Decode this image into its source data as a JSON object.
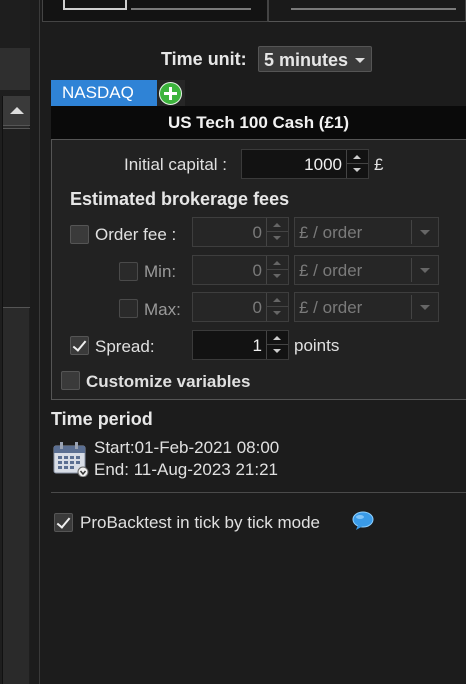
{
  "time_unit": {
    "label": "Time unit:",
    "value": "5 minutes"
  },
  "market_tab": {
    "label": "NASDAQ"
  },
  "instrument": {
    "name": "US Tech 100 Cash (£1)"
  },
  "capital": {
    "label": "Initial capital :",
    "value": "1000",
    "currency": "£"
  },
  "fees": {
    "title": "Estimated brokerage fees",
    "order_fee": {
      "label": "Order fee :",
      "value": "0",
      "unit": "£ / order",
      "checked": false
    },
    "min": {
      "label": "Min:",
      "value": "0",
      "unit": "£ / order",
      "checked": false
    },
    "max": {
      "label": "Max:",
      "value": "0",
      "unit": "£ / order",
      "checked": false
    },
    "spread": {
      "label": "Spread:",
      "value": "1",
      "unit": "points",
      "checked": true
    }
  },
  "customize": {
    "label": "Customize variables",
    "checked": false
  },
  "time_period": {
    "title": "Time period",
    "start": "Start:01-Feb-2021 08:00",
    "end": "End: 11-Aug-2023 21:21"
  },
  "tick_mode": {
    "label": "ProBacktest in tick by tick mode",
    "checked": true
  },
  "icons": [
    "calendar-icon",
    "chat-bubble-icon",
    "plus-icon",
    "scroll-up-arrow-icon"
  ],
  "colors": {
    "accent": "#2f83d6",
    "add": "#3db43d",
    "background": "#1c1c1c"
  }
}
